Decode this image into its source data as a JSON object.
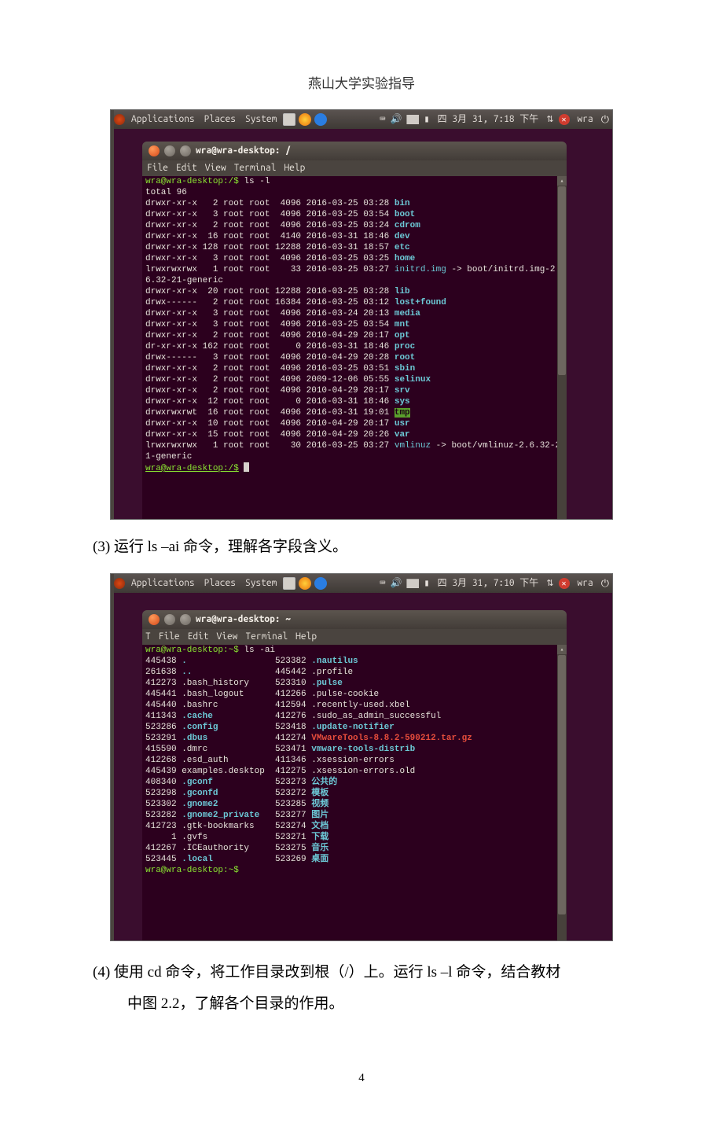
{
  "doc": {
    "header": "燕山大学实验指导",
    "line1": "(3)  运行 ls –ai 命令，理解各字段含义。",
    "line2a": "(4)  使用 cd 命令，将工作目录改到根（/）上。运行 ls –l 命令，结合教材",
    "line2b": "中图 2.2，了解各个目录的作用。",
    "pagenum": "4"
  },
  "bar1": {
    "clock": "四 3月 31,  7:18 下午",
    "user": "wra",
    "app": "Applications",
    "places": "Places",
    "sys": "System"
  },
  "bar2": {
    "clock": "四 3月 31,  7:10 下午",
    "user": "wra"
  },
  "win1": {
    "title": "wra@wra-desktop: /",
    "menu": {
      "f": "File",
      "e": "Edit",
      "v": "View",
      "t": "Terminal",
      "h": "Help"
    }
  },
  "win2": {
    "title": "wra@wra-desktop: ~",
    "menu": {
      "f": "File",
      "e": "Edit",
      "v": "View",
      "t": "Terminal",
      "h": "Help"
    }
  },
  "ls_l": {
    "prompt": "wra@wra-desktop:/$",
    "cmd": "ls -l",
    "total": "total 96",
    "endprompt": "wra@wra-desktop:/$",
    "rows": [
      {
        "perm": "drwxr-xr-x",
        "ln": "  2",
        "og": "root root",
        "sz": " 4096",
        "dt": "2016-03-25 03:28",
        "name": "bin",
        "cls": "b"
      },
      {
        "perm": "drwxr-xr-x",
        "ln": "  3",
        "og": "root root",
        "sz": " 4096",
        "dt": "2016-03-25 03:54",
        "name": "boot",
        "cls": "b"
      },
      {
        "perm": "drwxr-xr-x",
        "ln": "  2",
        "og": "root root",
        "sz": " 4096",
        "dt": "2016-03-25 03:24",
        "name": "cdrom",
        "cls": "b"
      },
      {
        "perm": "drwxr-xr-x",
        "ln": " 16",
        "og": "root root",
        "sz": " 4140",
        "dt": "2016-03-31 18:46",
        "name": "dev",
        "cls": "b"
      },
      {
        "perm": "drwxr-xr-x",
        "ln": "128",
        "og": "root root",
        "sz": "12288",
        "dt": "2016-03-31 18:57",
        "name": "etc",
        "cls": "b"
      },
      {
        "perm": "drwxr-xr-x",
        "ln": "  3",
        "og": "root root",
        "sz": " 4096",
        "dt": "2016-03-25 03:25",
        "name": "home",
        "cls": "b"
      },
      {
        "perm": "lrwxrwxrwx",
        "ln": "  1",
        "og": "root root",
        "sz": "   33",
        "dt": "2016-03-25 03:27",
        "name": "initrd.img",
        "cls": "cy",
        "link": " -> boot/initrd.img-2.",
        "cont": "6.32-21-generic"
      },
      {
        "perm": "drwxr-xr-x",
        "ln": " 20",
        "og": "root root",
        "sz": "12288",
        "dt": "2016-03-25 03:28",
        "name": "lib",
        "cls": "b"
      },
      {
        "perm": "drwx------",
        "ln": "  2",
        "og": "root root",
        "sz": "16384",
        "dt": "2016-03-25 03:12",
        "name": "lost+found",
        "cls": "b"
      },
      {
        "perm": "drwxr-xr-x",
        "ln": "  3",
        "og": "root root",
        "sz": " 4096",
        "dt": "2016-03-24 20:13",
        "name": "media",
        "cls": "b"
      },
      {
        "perm": "drwxr-xr-x",
        "ln": "  3",
        "og": "root root",
        "sz": " 4096",
        "dt": "2016-03-25 03:54",
        "name": "mnt",
        "cls": "b"
      },
      {
        "perm": "drwxr-xr-x",
        "ln": "  2",
        "og": "root root",
        "sz": " 4096",
        "dt": "2010-04-29 20:17",
        "name": "opt",
        "cls": "b"
      },
      {
        "perm": "dr-xr-xr-x",
        "ln": "162",
        "og": "root root",
        "sz": "    0",
        "dt": "2016-03-31 18:46",
        "name": "proc",
        "cls": "b"
      },
      {
        "perm": "drwx------",
        "ln": "  3",
        "og": "root root",
        "sz": " 4096",
        "dt": "2010-04-29 20:28",
        "name": "root",
        "cls": "b"
      },
      {
        "perm": "drwxr-xr-x",
        "ln": "  2",
        "og": "root root",
        "sz": " 4096",
        "dt": "2016-03-25 03:51",
        "name": "sbin",
        "cls": "b"
      },
      {
        "perm": "drwxr-xr-x",
        "ln": "  2",
        "og": "root root",
        "sz": " 4096",
        "dt": "2009-12-06 05:55",
        "name": "selinux",
        "cls": "b"
      },
      {
        "perm": "drwxr-xr-x",
        "ln": "  2",
        "og": "root root",
        "sz": " 4096",
        "dt": "2010-04-29 20:17",
        "name": "srv",
        "cls": "b"
      },
      {
        "perm": "drwxr-xr-x",
        "ln": " 12",
        "og": "root root",
        "sz": "    0",
        "dt": "2016-03-31 18:46",
        "name": "sys",
        "cls": "b"
      },
      {
        "perm": "drwxrwxrwt",
        "ln": " 16",
        "og": "root root",
        "sz": " 4096",
        "dt": "2016-03-31 19:01",
        "name": "tmp",
        "cls": "hl"
      },
      {
        "perm": "drwxr-xr-x",
        "ln": " 10",
        "og": "root root",
        "sz": " 4096",
        "dt": "2010-04-29 20:17",
        "name": "usr",
        "cls": "b"
      },
      {
        "perm": "drwxr-xr-x",
        "ln": " 15",
        "og": "root root",
        "sz": " 4096",
        "dt": "2010-04-29 20:26",
        "name": "var",
        "cls": "b"
      },
      {
        "perm": "lrwxrwxrwx",
        "ln": "  1",
        "og": "root root",
        "sz": "   30",
        "dt": "2016-03-25 03:27",
        "name": "vmlinuz",
        "cls": "cy",
        "link": " -> boot/vmlinuz-2.6.32-2",
        "cont": "1-generic"
      }
    ]
  },
  "ls_ai": {
    "prompt": "wra@wra-desktop:~$",
    "cmd": "ls -ai",
    "endprompt": "wra@wra-desktop:~$",
    "col1": [
      {
        "i": "445438",
        "n": ".",
        "c": "b"
      },
      {
        "i": "261638",
        "n": "..",
        "c": "b"
      },
      {
        "i": "412273",
        "n": ".bash_history",
        "c": ""
      },
      {
        "i": "445441",
        "n": ".bash_logout",
        "c": ""
      },
      {
        "i": "445440",
        "n": ".bashrc",
        "c": ""
      },
      {
        "i": "411343",
        "n": ".cache",
        "c": "b"
      },
      {
        "i": "523286",
        "n": ".config",
        "c": "b"
      },
      {
        "i": "523291",
        "n": ".dbus",
        "c": "b"
      },
      {
        "i": "415590",
        "n": ".dmrc",
        "c": ""
      },
      {
        "i": "412268",
        "n": ".esd_auth",
        "c": ""
      },
      {
        "i": "445439",
        "n": "examples.desktop",
        "c": ""
      },
      {
        "i": "408340",
        "n": ".gconf",
        "c": "b"
      },
      {
        "i": "523298",
        "n": ".gconfd",
        "c": "b"
      },
      {
        "i": "523302",
        "n": ".gnome2",
        "c": "b"
      },
      {
        "i": "523282",
        "n": ".gnome2_private",
        "c": "b"
      },
      {
        "i": "412723",
        "n": ".gtk-bookmarks",
        "c": ""
      },
      {
        "i": "     1",
        "n": ".gvfs",
        "c": ""
      },
      {
        "i": "412267",
        "n": ".ICEauthority",
        "c": ""
      },
      {
        "i": "523445",
        "n": ".local",
        "c": "b"
      }
    ],
    "col2": [
      {
        "i": "523382",
        "n": ".nautilus",
        "c": "b"
      },
      {
        "i": "445442",
        "n": ".profile",
        "c": ""
      },
      {
        "i": "523310",
        "n": ".pulse",
        "c": "b"
      },
      {
        "i": "412266",
        "n": ".pulse-cookie",
        "c": ""
      },
      {
        "i": "412594",
        "n": ".recently-used.xbel",
        "c": ""
      },
      {
        "i": "412276",
        "n": ".sudo_as_admin_successful",
        "c": ""
      },
      {
        "i": "523418",
        "n": ".update-notifier",
        "c": "b"
      },
      {
        "i": "412274",
        "n": "VMwareTools-8.8.2-590212.tar.gz",
        "c": "r"
      },
      {
        "i": "523471",
        "n": "vmware-tools-distrib",
        "c": "b"
      },
      {
        "i": "411346",
        "n": ".xsession-errors",
        "c": ""
      },
      {
        "i": "412275",
        "n": ".xsession-errors.old",
        "c": ""
      },
      {
        "i": "523273",
        "n": "公共的",
        "c": "b"
      },
      {
        "i": "523272",
        "n": "模板",
        "c": "b"
      },
      {
        "i": "523285",
        "n": "视频",
        "c": "b"
      },
      {
        "i": "523277",
        "n": "图片",
        "c": "b"
      },
      {
        "i": "523274",
        "n": "文档",
        "c": "b"
      },
      {
        "i": "523271",
        "n": "下载",
        "c": "b"
      },
      {
        "i": "523275",
        "n": "音乐",
        "c": "b"
      },
      {
        "i": "523269",
        "n": "桌面",
        "c": "b"
      }
    ]
  }
}
